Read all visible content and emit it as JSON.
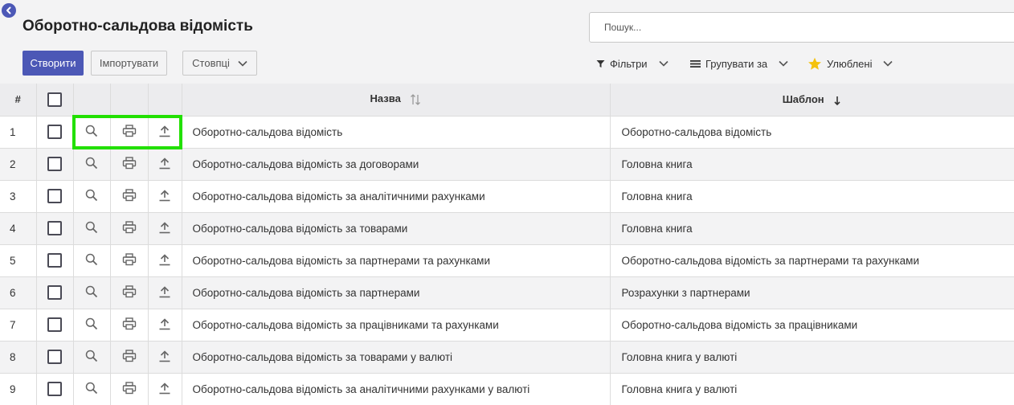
{
  "header": {
    "title": "Оборотно-сальдова відомість",
    "search_placeholder": "Пошук..."
  },
  "toolbar": {
    "create_label": "Створити",
    "import_label": "Імпортувати",
    "columns_label": "Стовпці"
  },
  "filters": {
    "filters_label": "Фільтри",
    "group_label": "Групувати за",
    "favorites_label": "Улюблені"
  },
  "table": {
    "columns": {
      "num": "#",
      "name": "Назва",
      "template": "Шаблон"
    },
    "rows": [
      {
        "num": "1",
        "name": "Оборотно-сальдова відомість",
        "template": "Оборотно-сальдова відомість"
      },
      {
        "num": "2",
        "name": "Оборотно-сальдова відомість за договорами",
        "template": "Головна книга"
      },
      {
        "num": "3",
        "name": "Оборотно-сальдова відомість за аналітичними рахунками",
        "template": "Головна книга"
      },
      {
        "num": "4",
        "name": "Оборотно-сальдова відомість за товарами",
        "template": "Головна книга"
      },
      {
        "num": "5",
        "name": "Оборотно-сальдова відомість за партнерами та рахунками",
        "template": "Оборотно-сальдова відомість за партнерами та рахунками"
      },
      {
        "num": "6",
        "name": "Оборотно-сальдова відомість за партнерами",
        "template": "Розрахунки з партнерами"
      },
      {
        "num": "7",
        "name": "Оборотно-сальдова відомість за працівниками та рахунками",
        "template": "Оборотно-сальдова відомість за працівниками"
      },
      {
        "num": "8",
        "name": "Оборотно-сальдова відомість за товарами у валюті",
        "template": "Головна книга у валюті"
      },
      {
        "num": "9",
        "name": "Оборотно-сальдова відомість за аналітичними рахунками у валюті",
        "template": "Головна книга у валюті"
      }
    ]
  },
  "icons": {
    "back": "chevron-left-icon",
    "search": "magnifier-icon",
    "print": "printer-icon",
    "export": "upload-icon",
    "filter": "funnel-icon",
    "group": "list-icon",
    "favorite": "star-icon"
  },
  "colors": {
    "primary": "#4c58b6",
    "highlight": "#22e000",
    "star": "#f4c20d"
  }
}
